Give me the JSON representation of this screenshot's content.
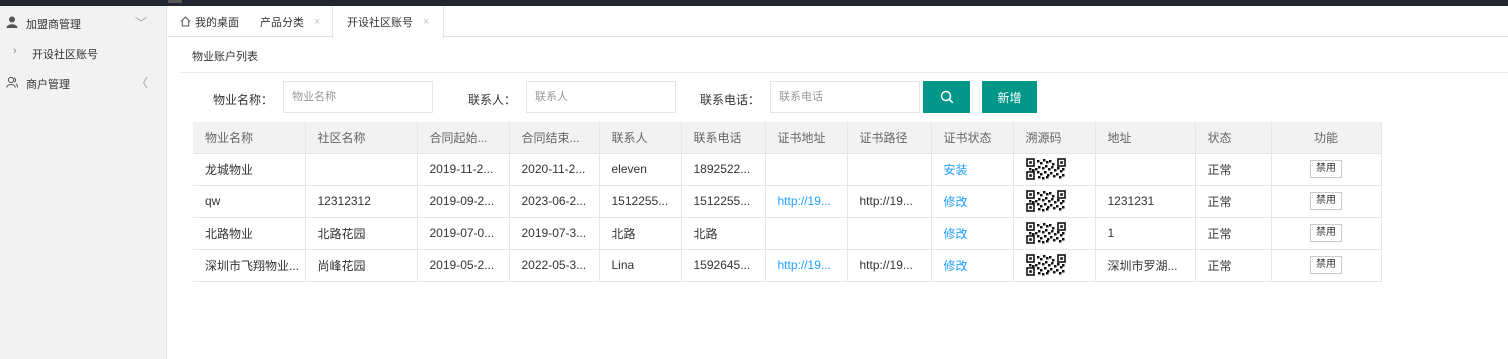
{
  "sidebar": {
    "items": [
      {
        "label": "加盟商管理",
        "icon": "user-icon",
        "arrow": "﹀"
      },
      {
        "label": "开设社区账号",
        "icon": "chevron-right-icon"
      },
      {
        "label": "商户管理",
        "icon": "users-icon",
        "arrow": "〈"
      }
    ]
  },
  "tabs": [
    {
      "label": "我的桌面",
      "icon": "home-icon"
    },
    {
      "label": "产品分类",
      "close": "×"
    },
    {
      "label": "开设社区账号",
      "close": "×"
    }
  ],
  "breadcrumb": "物业账户列表",
  "search": {
    "property_label": "物业名称：",
    "property_placeholder": "物业名称",
    "contact_label": "联系人：",
    "contact_placeholder": "联系人",
    "phone_label": "联系电话：",
    "phone_placeholder": "联系电话",
    "search_icon": "search-icon",
    "add_label": "新增",
    "accent": "#009688"
  },
  "table": {
    "headers": [
      "物业名称",
      "社区名称",
      "合同起始...",
      "合同结束...",
      "联系人",
      "联系电话",
      "证书地址",
      "证书路径",
      "证书状态",
      "溯源码",
      "地址",
      "状态",
      "功能"
    ],
    "rows": [
      {
        "name": "龙城物业",
        "community": "",
        "start": "2019-11-2...",
        "end": "2020-11-2...",
        "contact": "eleven",
        "phone": "1892522...",
        "cert_url": "",
        "cert_path": "",
        "cert_status": "安装",
        "address": "",
        "status": "正常",
        "action": "禁用"
      },
      {
        "name": "qw",
        "community": "12312312",
        "start": "2019-09-2...",
        "end": "2023-06-2...",
        "contact": "1512255...",
        "phone": "1512255...",
        "cert_url": "http://19...",
        "cert_path": "http://19...",
        "cert_status": "修改",
        "address": "1231231",
        "status": "正常",
        "action": "禁用"
      },
      {
        "name": "北路物业",
        "community": "北路花园",
        "start": "2019-07-0...",
        "end": "2019-07-3...",
        "contact": "北路",
        "phone": "北路",
        "cert_url": "",
        "cert_path": "",
        "cert_status": "修改",
        "address": "1",
        "status": "正常",
        "action": "禁用"
      },
      {
        "name": "深圳市飞翔物业...",
        "community": "尚峰花园",
        "start": "2019-05-2...",
        "end": "2022-05-3...",
        "contact": "Lina",
        "phone": "1592645...",
        "cert_url": "http://19...",
        "cert_path": "http://19...",
        "cert_status": "修改",
        "address": "深圳市罗湖...",
        "status": "正常",
        "action": "禁用"
      }
    ]
  }
}
